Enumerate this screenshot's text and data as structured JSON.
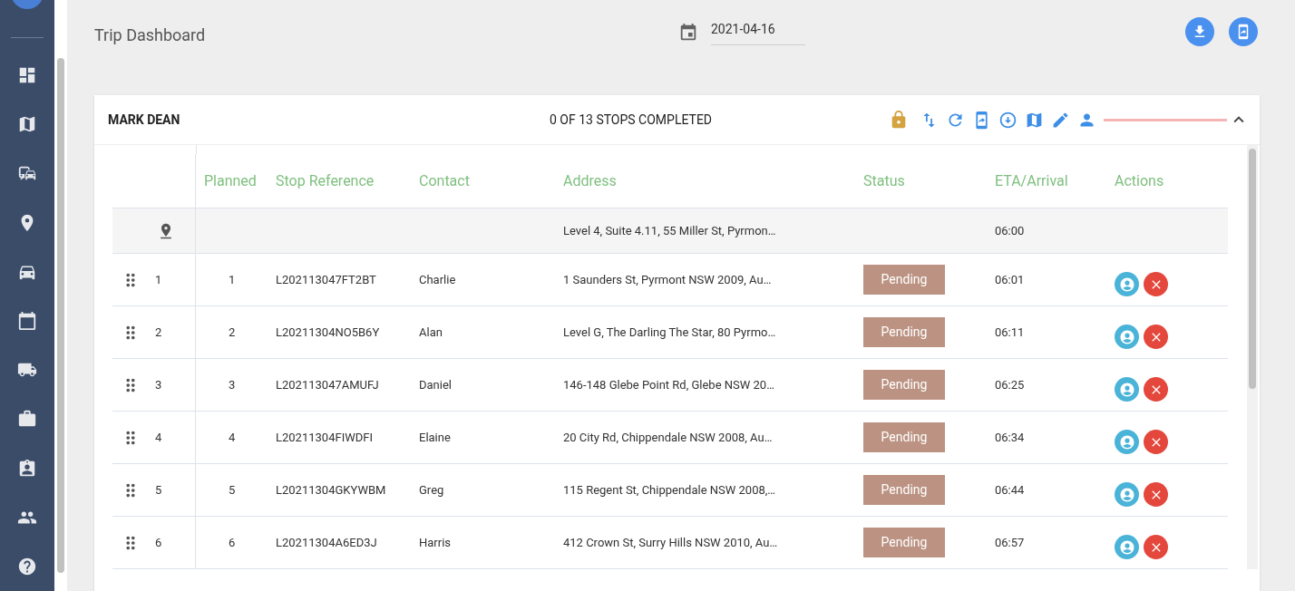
{
  "page": {
    "title": "Trip Dashboard",
    "date": "2021-04-16"
  },
  "trip": {
    "driver": "MARK DEAN",
    "summary": "0 OF 13 STOPS COMPLETED",
    "locked": true,
    "expanded": true,
    "progress": {
      "level": 0
    }
  },
  "table": {
    "columns": [
      "Planned",
      "Stop Reference",
      "Contact",
      "Address",
      "Status",
      "ETA/Arrival",
      "Actions"
    ],
    "depot": {
      "address": "Level 4, Suite 4.11, 55 Miller St, Pyrmon…",
      "eta": "06:00"
    },
    "rows": [
      {
        "index": "1",
        "planned": "1",
        "reference": "L202113047FT2BT",
        "contact": "Charlie",
        "address": "1 Saunders St, Pyrmont NSW 2009, Au…",
        "status": "Pending",
        "eta": "06:01"
      },
      {
        "index": "2",
        "planned": "2",
        "reference": "L20211304NO5B6Y",
        "contact": "Alan",
        "address": "Level G, The Darling The Star, 80 Pyrmo…",
        "status": "Pending",
        "eta": "06:11"
      },
      {
        "index": "3",
        "planned": "3",
        "reference": "L202113047AMUFJ",
        "contact": "Daniel",
        "address": "146-148 Glebe Point Rd, Glebe NSW 20…",
        "status": "Pending",
        "eta": "06:25"
      },
      {
        "index": "4",
        "planned": "4",
        "reference": "L20211304FIWDFI",
        "contact": "Elaine",
        "address": "20 City Rd, Chippendale NSW 2008, Au…",
        "status": "Pending",
        "eta": "06:34"
      },
      {
        "index": "5",
        "planned": "5",
        "reference": "L20211304GKYWBM",
        "contact": "Greg",
        "address": "115 Regent St, Chippendale NSW 2008,…",
        "status": "Pending",
        "eta": "06:44"
      },
      {
        "index": "6",
        "planned": "6",
        "reference": "L20211304A6ED3J",
        "contact": "Harris",
        "address": "412 Crown St, Surry Hills NSW 2010, Au…",
        "status": "Pending",
        "eta": "06:57"
      }
    ]
  }
}
